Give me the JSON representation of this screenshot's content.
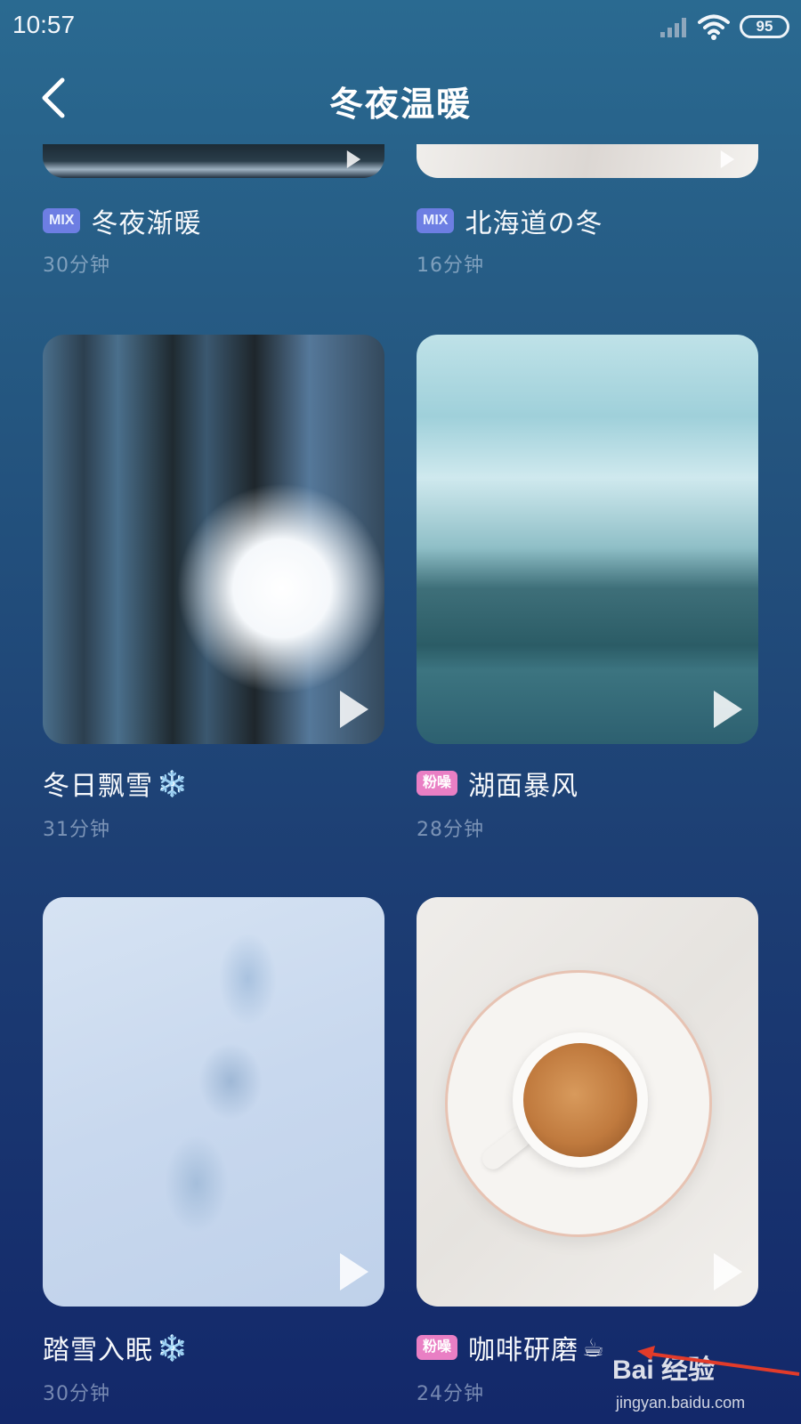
{
  "status_bar": {
    "time": "10:57",
    "battery": "95"
  },
  "header": {
    "title": "冬夜温暖"
  },
  "cards": [
    {
      "tag": "MIX",
      "title": "冬夜渐暖",
      "duration": "30分钟"
    },
    {
      "tag": "MIX",
      "title": "北海道の冬",
      "duration": "16分钟"
    },
    {
      "tag": "",
      "title": "冬日飘雪",
      "emoji": "❄️",
      "duration": "31分钟"
    },
    {
      "tag": "粉噪",
      "title": "湖面暴风",
      "duration": "28分钟"
    },
    {
      "tag": "",
      "title": "踏雪入眠",
      "emoji": "❄️",
      "duration": "30分钟"
    },
    {
      "tag": "粉噪",
      "title": "咖啡研磨",
      "emoji": "☕",
      "duration": "24分钟"
    }
  ],
  "watermark": {
    "logo": "Bai 经验",
    "url": "jingyan.baidu.com"
  },
  "colors": {
    "tag_mix": "#6d7ee3",
    "tag_pink": "#e97fc4",
    "duration_text": "#8fa3bf"
  }
}
